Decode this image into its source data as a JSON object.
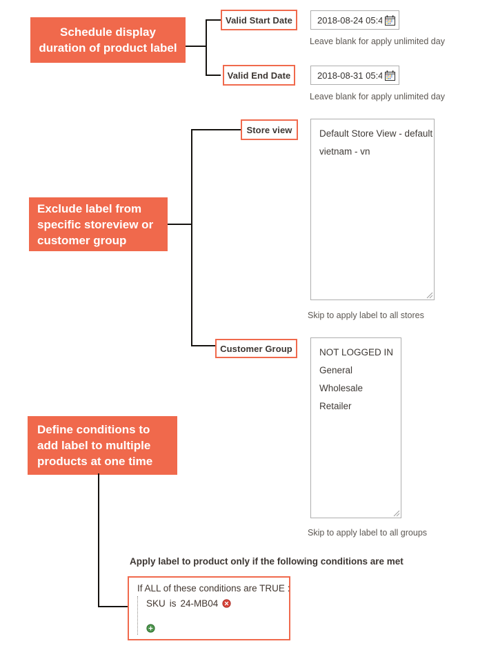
{
  "theme": {
    "accent": "#F0694C",
    "connector": "#15120f",
    "input_border": "#adadad",
    "text": "#41362f",
    "hint_text": "#5b5651"
  },
  "callouts": [
    {
      "id": "schedule",
      "text": "Schedule display duration of product label"
    },
    {
      "id": "exclude",
      "text": "Exclude label from specific storeview or customer group"
    },
    {
      "id": "conditions",
      "text": "Define conditions to add label to multiple products at one time"
    }
  ],
  "fields": {
    "valid_start_date": {
      "label": "Valid Start Date",
      "value": "2018-08-24 05:4",
      "hint": "Leave blank for apply unlimited day",
      "icon": "calendar-icon"
    },
    "valid_end_date": {
      "label": "Valid End Date",
      "value": "2018-08-31 05:4",
      "hint": "Leave blank for apply unlimited day",
      "icon": "calendar-icon"
    },
    "store_view": {
      "label": "Store view",
      "options": [
        "Default Store View - default",
        "vietnam - vn"
      ],
      "hint": "Skip to apply label to all stores"
    },
    "customer_group": {
      "label": "Customer Group",
      "options": [
        "NOT LOGGED IN",
        "General",
        "Wholesale",
        "Retailer"
      ],
      "hint": "Skip to apply label to all groups"
    }
  },
  "conditions": {
    "heading": "Apply label to product only if the following conditions are met",
    "aggregator_line": "If ALL  of these conditions are TRUE :",
    "rows": [
      {
        "attribute": "SKU",
        "operator": "is",
        "value": "24-MB04",
        "remove_icon": "remove-circle-icon"
      }
    ],
    "add_icon": "add-circle-icon"
  }
}
